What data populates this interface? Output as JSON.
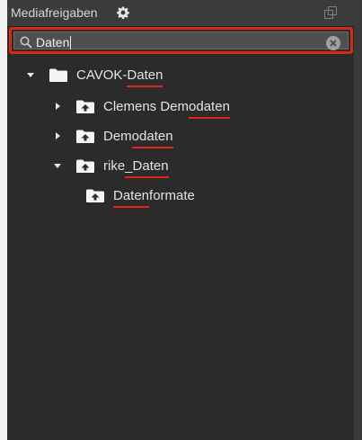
{
  "header": {
    "title": "Mediafreigaben",
    "settings_icon": "gear-icon",
    "detach_icon": "detach-icon"
  },
  "search": {
    "value": "Daten",
    "search_icon": "search-icon",
    "clear_icon": "clear-icon",
    "highlight_color": "#d62812"
  },
  "tree": {
    "items": [
      {
        "pre": "CAVOK-",
        "match": "Daten",
        "post": "",
        "depth": 0,
        "expanded": true,
        "icon": "folder-icon"
      },
      {
        "pre": "Clemens Dem",
        "match": "odaten",
        "post": "",
        "depth": 1,
        "expanded": false,
        "icon": "shared-folder-icon"
      },
      {
        "pre": "Dem",
        "match": "odaten",
        "post": "",
        "depth": 1,
        "expanded": false,
        "icon": "shared-folder-icon"
      },
      {
        "pre": "rike",
        "match": "_Daten",
        "post": "",
        "depth": 1,
        "expanded": true,
        "icon": "shared-folder-icon"
      },
      {
        "pre": "",
        "match": "Daten",
        "post": "formate",
        "depth": 2,
        "expanded": null,
        "icon": "shared-folder-icon"
      }
    ],
    "underline_color": "#e0271d"
  }
}
